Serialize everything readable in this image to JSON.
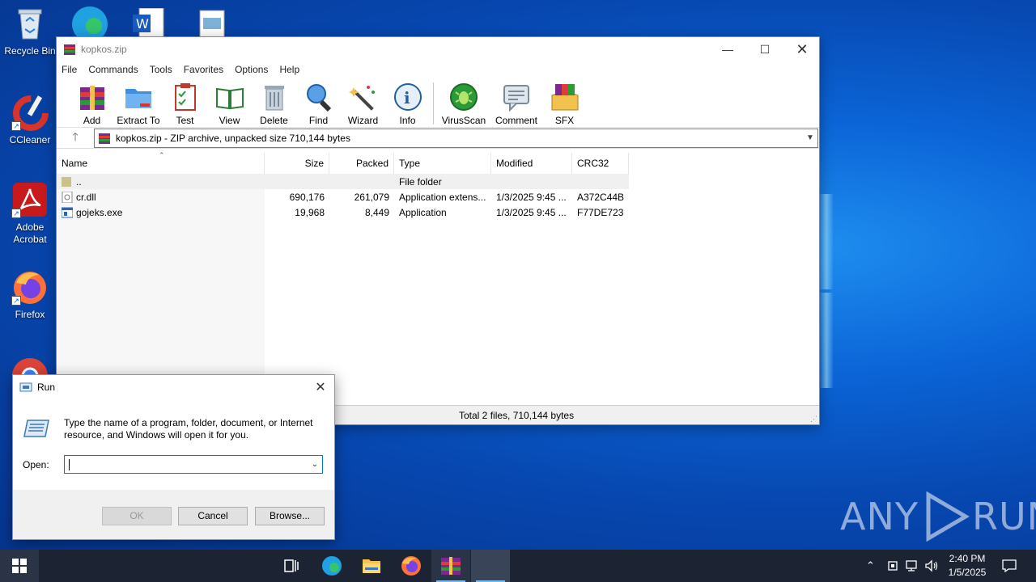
{
  "desktop": {
    "icons": [
      {
        "label": "Recycle Bin"
      },
      {
        "label": "CCleaner"
      },
      {
        "label": "Adobe Acrobat"
      },
      {
        "label": "Firefox"
      }
    ],
    "watermark": {
      "left": "ANY",
      "right": "RUN"
    }
  },
  "winrar": {
    "title": "kopkos.zip",
    "menu": [
      "File",
      "Commands",
      "Tools",
      "Favorites",
      "Options",
      "Help"
    ],
    "toolbar": [
      "Add",
      "Extract To",
      "Test",
      "View",
      "Delete",
      "Find",
      "Wizard",
      "Info",
      "VirusScan",
      "Comment",
      "SFX"
    ],
    "address": "kopkos.zip - ZIP archive, unpacked size 710,144 bytes",
    "columns": [
      "Name",
      "Size",
      "Packed",
      "Type",
      "Modified",
      "CRC32"
    ],
    "rows": [
      {
        "name": "..",
        "size": "",
        "packed": "",
        "type": "File folder",
        "modified": "",
        "crc": ""
      },
      {
        "name": "cr.dll",
        "size": "690,176",
        "packed": "261,079",
        "type": "Application extens...",
        "modified": "1/3/2025 9:45 ...",
        "crc": "A372C44B"
      },
      {
        "name": "gojeks.exe",
        "size": "19,968",
        "packed": "8,449",
        "type": "Application",
        "modified": "1/3/2025 9:45 ...",
        "crc": "F77DE723"
      }
    ],
    "status": "Total 2 files, 710,144 bytes"
  },
  "run": {
    "title": "Run",
    "description": "Type the name of a program, folder, document, or Internet resource, and Windows will open it for you.",
    "open_label": "Open:",
    "open_value": "",
    "ok": "OK",
    "cancel": "Cancel",
    "browse": "Browse..."
  },
  "taskbar": {
    "time": "2:40 PM",
    "date": "1/5/2025"
  }
}
